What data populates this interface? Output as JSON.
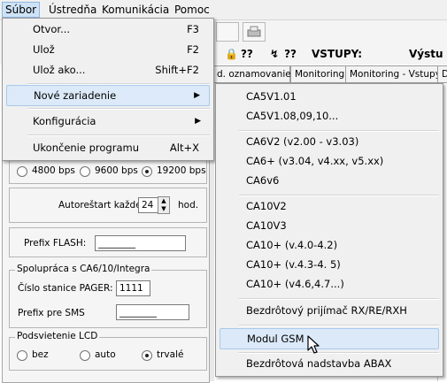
{
  "menubar": {
    "items": [
      "Súbor",
      "Ústredňa",
      "Komunikácia",
      "Pomoc"
    ]
  },
  "toolbar": {
    "status_q1": "??",
    "status_q2": "??",
    "vstupy": "VSTUPY:",
    "vystup": "Výstu"
  },
  "tabs": [
    "d. oznamovanie",
    "Monitoring",
    "Monitoring - Vstupy",
    "De"
  ],
  "left_panel": {
    "baud_options": [
      {
        "label": "4800 bps",
        "selected": false
      },
      {
        "label": "9600 bps",
        "selected": false
      },
      {
        "label": "19200 bps",
        "selected": true
      }
    ],
    "autorestart_label": "Autoreštart každé:",
    "autorestart_value": "24",
    "autorestart_unit": "hod.",
    "prefix_flash_label": "Prefix FLASH:",
    "prefix_flash_value": "________",
    "spoluprace_title": "Spolupráca s CA6/10/Integra",
    "pager_label": "Číslo stanice PAGER:",
    "pager_value": "1111",
    "prefix_sms_label": "Prefix pre SMS",
    "prefix_sms_value": "________",
    "lcd_title": "Podsvietenie LCD",
    "lcd_options": [
      {
        "label": "bez",
        "selected": false
      },
      {
        "label": "auto",
        "selected": false
      },
      {
        "label": "trvalé",
        "selected": true
      }
    ]
  },
  "file_menu": {
    "items": [
      {
        "label": "Otvor...",
        "shortcut": "F3"
      },
      {
        "label": "Ulož",
        "shortcut": "F2"
      },
      {
        "label": "Ulož ako...",
        "shortcut": "Shift+F2"
      },
      {
        "label": "Nové zariadenie",
        "submenu": true
      },
      {
        "label": "Konfigurácia",
        "submenu": true
      },
      {
        "label": "Ukončenie programu",
        "shortcut": "Alt+X"
      }
    ]
  },
  "device_submenu": {
    "items": [
      "CA5V1.01",
      "CA5V1.08,09,10...",
      "CA6V2 (v2.00 - v3.03)",
      "CA6+ (v3.04, v4.xx, v5.xx)",
      "CA6v6",
      "CA10V2",
      "CA10V3",
      "CA10+ (v.4.0-4.2)",
      "CA10+ (v.4.3-4. 5)",
      "CA10+ (v4.6,4.7...)",
      "Bezdrôtový prijímač RX/RE/RXH",
      "Modul GSM",
      "Bezdrôtová nadstavba ABAX"
    ],
    "highlighted": "Modul GSM"
  }
}
